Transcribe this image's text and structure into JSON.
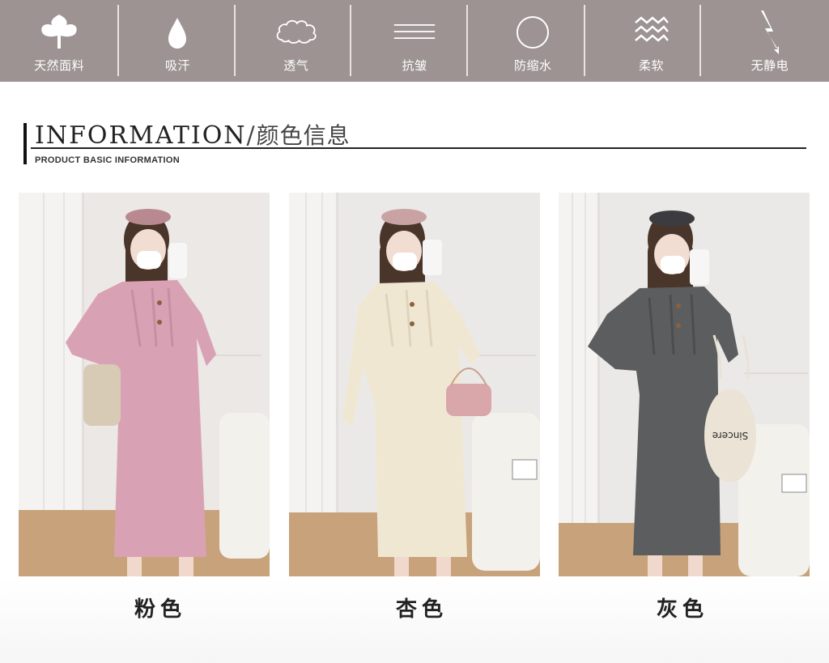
{
  "features": [
    {
      "icon": "leaf-icon",
      "label": "天然面料"
    },
    {
      "icon": "water-drop-icon",
      "label": "吸汗"
    },
    {
      "icon": "cloud-icon",
      "label": "透气"
    },
    {
      "icon": "lines-icon",
      "label": "抗皱"
    },
    {
      "icon": "circle-icon",
      "label": "防缩水"
    },
    {
      "icon": "waves-icon",
      "label": "柔软"
    },
    {
      "icon": "lightning-icon",
      "label": "无静电"
    }
  ],
  "info": {
    "title_en": "INFORMATION",
    "slash": "/",
    "title_cn": "颜色信息",
    "subtitle": "PRODUCT BASIC INFORMATION"
  },
  "products": [
    {
      "color_name": "粉色",
      "dress_color": "#d9a2b4"
    },
    {
      "color_name": "杏色",
      "dress_color": "#f0e7d3"
    },
    {
      "color_name": "灰色",
      "dress_color": "#5c5d5f"
    }
  ],
  "tote_text": "Sincere"
}
